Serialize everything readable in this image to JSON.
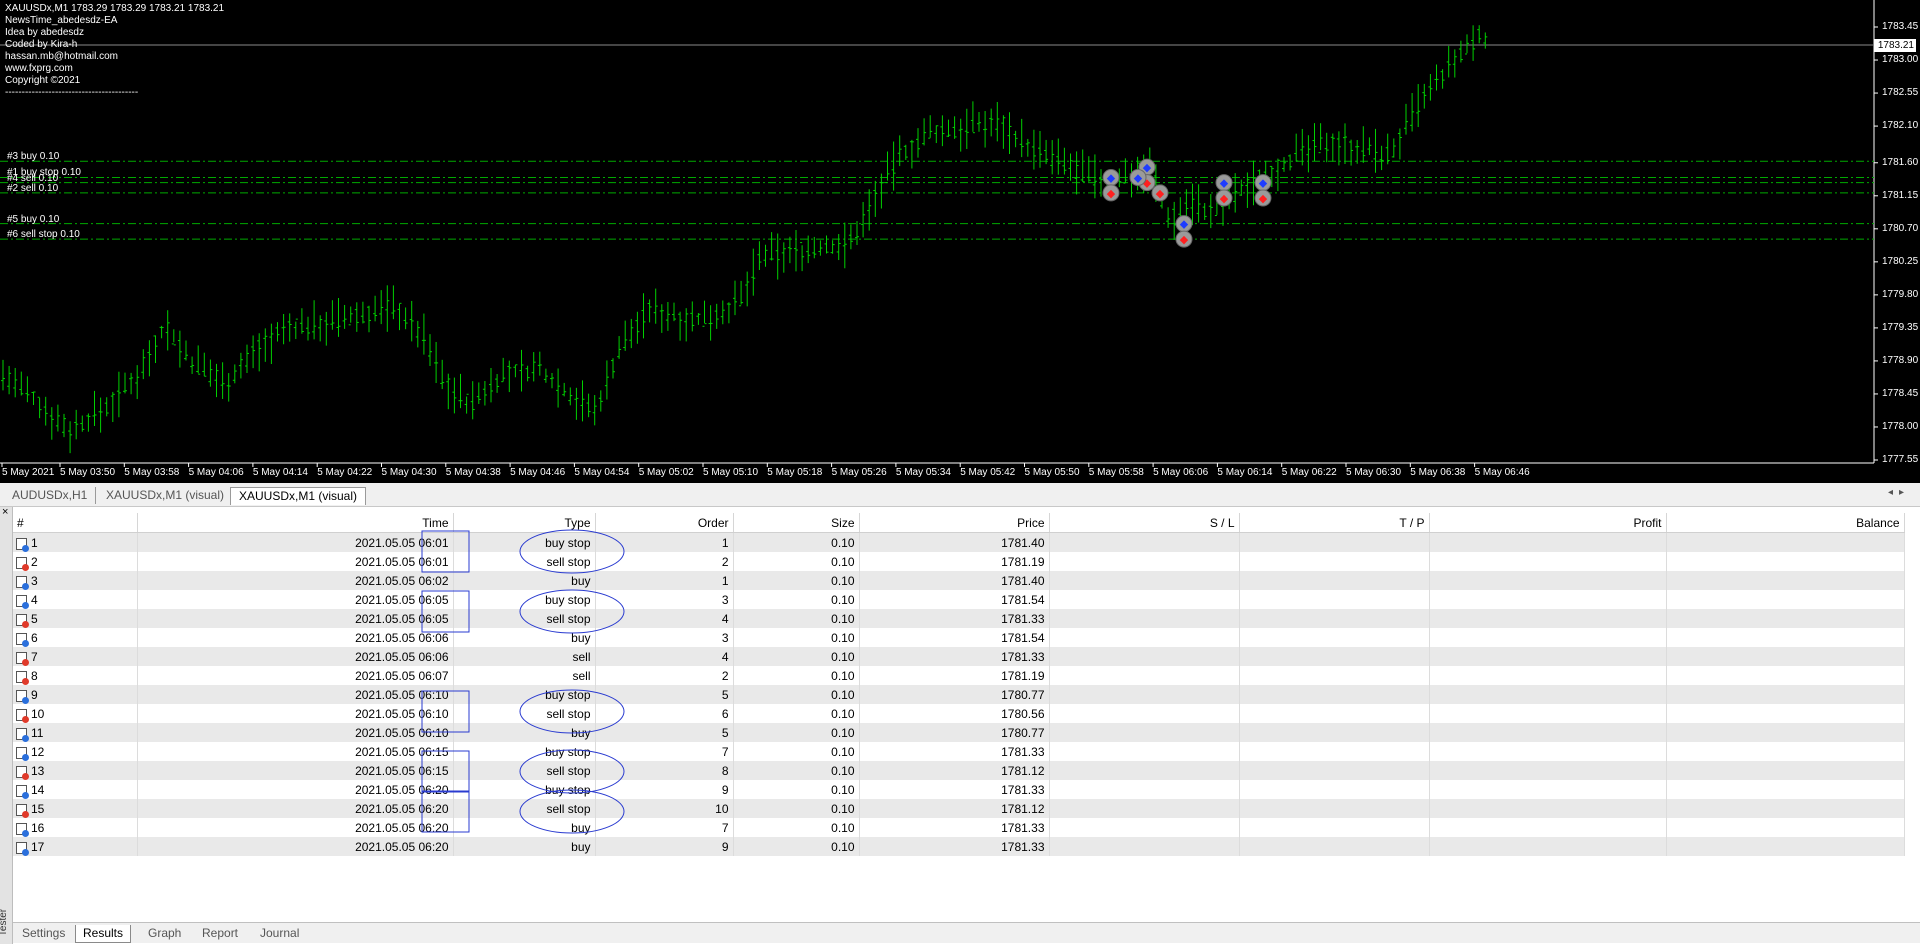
{
  "chart": {
    "info_lines": [
      "XAUUSDx,M1  1783.29 1783.29 1783.21 1783.21",
      "NewsTime_abedesdz-EA",
      "Idea by abedesdz",
      "Coded by Kira-h",
      "hassan.mb@hotmail.com",
      "www.fxprg.com",
      "Copyright ©2021",
      "----------------------------------------"
    ],
    "current_price": "1783.21",
    "price_axis": [
      "1783.45",
      "1783.00",
      "1782.55",
      "1782.10",
      "1781.60",
      "1781.15",
      "1780.70",
      "1780.25",
      "1779.80",
      "1779.35",
      "1778.90",
      "1778.45",
      "1778.00",
      "1777.55"
    ],
    "time_axis": [
      "5 May 2021",
      "5 May 03:50",
      "5 May 03:58",
      "5 May 04:06",
      "5 May 04:14",
      "5 May 04:22",
      "5 May 04:30",
      "5 May 04:38",
      "5 May 04:46",
      "5 May 04:54",
      "5 May 05:02",
      "5 May 05:10",
      "5 May 05:18",
      "5 May 05:26",
      "5 May 05:34",
      "5 May 05:42",
      "5 May 05:50",
      "5 May 05:58",
      "5 May 06:06",
      "5 May 06:14",
      "5 May 06:22",
      "5 May 06:30",
      "5 May 06:38",
      "5 May 06:46"
    ],
    "order_labels": [
      {
        "text": "#3 buy 0.10",
        "price": 1781.62
      },
      {
        "text": "#1 buy stop 0.10",
        "price": 1781.4
      },
      {
        "text": "#4 sell 0.10",
        "price": 1781.33
      },
      {
        "text": "#2 sell 0.10",
        "price": 1781.19
      },
      {
        "text": "#5 buy 0.10",
        "price": 1780.77
      },
      {
        "text": "#6 sell stop 0.10",
        "price": 1780.56
      }
    ],
    "colors": {
      "candle": "#00d000",
      "level": "#00aa00",
      "background": "#000000"
    }
  },
  "chart_tabs": [
    "AUDUSDx,H1",
    "XAUUSDx,M1 (visual)",
    "XAUUSDx,M1 (visual)"
  ],
  "table": {
    "headers": [
      "#",
      "Time",
      "Type",
      "Order",
      "Size",
      "Price",
      "S / L",
      "T / P",
      "Profit",
      "Balance"
    ],
    "rows": [
      {
        "num": "1",
        "time": "2021.05.05 06:01",
        "type": "buy stop",
        "order": "1",
        "size": "0.10",
        "price": "1781.40",
        "kind": "pending"
      },
      {
        "num": "2",
        "time": "2021.05.05 06:01",
        "type": "sell stop",
        "order": "2",
        "size": "0.10",
        "price": "1781.19",
        "kind": "pending"
      },
      {
        "num": "3",
        "time": "2021.05.05 06:02",
        "type": "buy",
        "order": "1",
        "size": "0.10",
        "price": "1781.40",
        "kind": "market"
      },
      {
        "num": "4",
        "time": "2021.05.05 06:05",
        "type": "buy stop",
        "order": "3",
        "size": "0.10",
        "price": "1781.54",
        "kind": "pending"
      },
      {
        "num": "5",
        "time": "2021.05.05 06:05",
        "type": "sell stop",
        "order": "4",
        "size": "0.10",
        "price": "1781.33",
        "kind": "pending"
      },
      {
        "num": "6",
        "time": "2021.05.05 06:06",
        "type": "buy",
        "order": "3",
        "size": "0.10",
        "price": "1781.54",
        "kind": "market"
      },
      {
        "num": "7",
        "time": "2021.05.05 06:06",
        "type": "sell",
        "order": "4",
        "size": "0.10",
        "price": "1781.33",
        "kind": "market"
      },
      {
        "num": "8",
        "time": "2021.05.05 06:07",
        "type": "sell",
        "order": "2",
        "size": "0.10",
        "price": "1781.19",
        "kind": "market"
      },
      {
        "num": "9",
        "time": "2021.05.05 06:10",
        "type": "buy stop",
        "order": "5",
        "size": "0.10",
        "price": "1780.77",
        "kind": "pending"
      },
      {
        "num": "10",
        "time": "2021.05.05 06:10",
        "type": "sell stop",
        "order": "6",
        "size": "0.10",
        "price": "1780.56",
        "kind": "pending"
      },
      {
        "num": "11",
        "time": "2021.05.05 06:10",
        "type": "buy",
        "order": "5",
        "size": "0.10",
        "price": "1780.77",
        "kind": "market"
      },
      {
        "num": "12",
        "time": "2021.05.05 06:15",
        "type": "buy stop",
        "order": "7",
        "size": "0.10",
        "price": "1781.33",
        "kind": "pending"
      },
      {
        "num": "13",
        "time": "2021.05.05 06:15",
        "type": "sell stop",
        "order": "8",
        "size": "0.10",
        "price": "1781.12",
        "kind": "pending"
      },
      {
        "num": "14",
        "time": "2021.05.05 06:20",
        "type": "buy stop",
        "order": "9",
        "size": "0.10",
        "price": "1781.33",
        "kind": "pending"
      },
      {
        "num": "15",
        "time": "2021.05.05 06:20",
        "type": "sell stop",
        "order": "10",
        "size": "0.10",
        "price": "1781.12",
        "kind": "pending"
      },
      {
        "num": "16",
        "time": "2021.05.05 06:20",
        "type": "buy",
        "order": "7",
        "size": "0.10",
        "price": "1781.33",
        "kind": "market"
      },
      {
        "num": "17",
        "time": "2021.05.05 06:20",
        "type": "buy",
        "order": "9",
        "size": "0.10",
        "price": "1781.33",
        "kind": "market"
      }
    ]
  },
  "tester_label": "Tester",
  "bottom_tabs": [
    "Settings",
    "Results",
    "Graph",
    "Report",
    "Journal"
  ],
  "active_bottom_tab": "Results"
}
